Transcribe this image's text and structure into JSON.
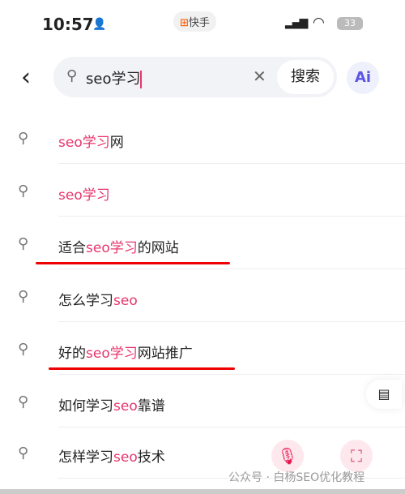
{
  "status": {
    "time": "10:57",
    "app": "快手",
    "battery": "33"
  },
  "search": {
    "query": "seo学习",
    "button": "搜索",
    "ai": "Ai"
  },
  "suggestions": [
    {
      "pre": "",
      "hl": "seo学习",
      "post": "网"
    },
    {
      "pre": "",
      "hl": "seo学习",
      "post": ""
    },
    {
      "pre": "适合",
      "hl": "seo学习",
      "post": "的网站",
      "underlined": true
    },
    {
      "pre": "怎么学习",
      "hl": "seo",
      "post": ""
    },
    {
      "pre": "好的",
      "hl": "seo学习",
      "post": "网站推广",
      "underlined": true
    },
    {
      "pre": "如何学习",
      "hl": "seo",
      "post": "靠谱"
    },
    {
      "pre": "怎样学习",
      "hl": "seo",
      "post": "技术"
    }
  ],
  "watermark": "公众号 · 白杨SEO优化教程",
  "colors": {
    "highlight": "#e8356d",
    "underline": "#e00000"
  }
}
